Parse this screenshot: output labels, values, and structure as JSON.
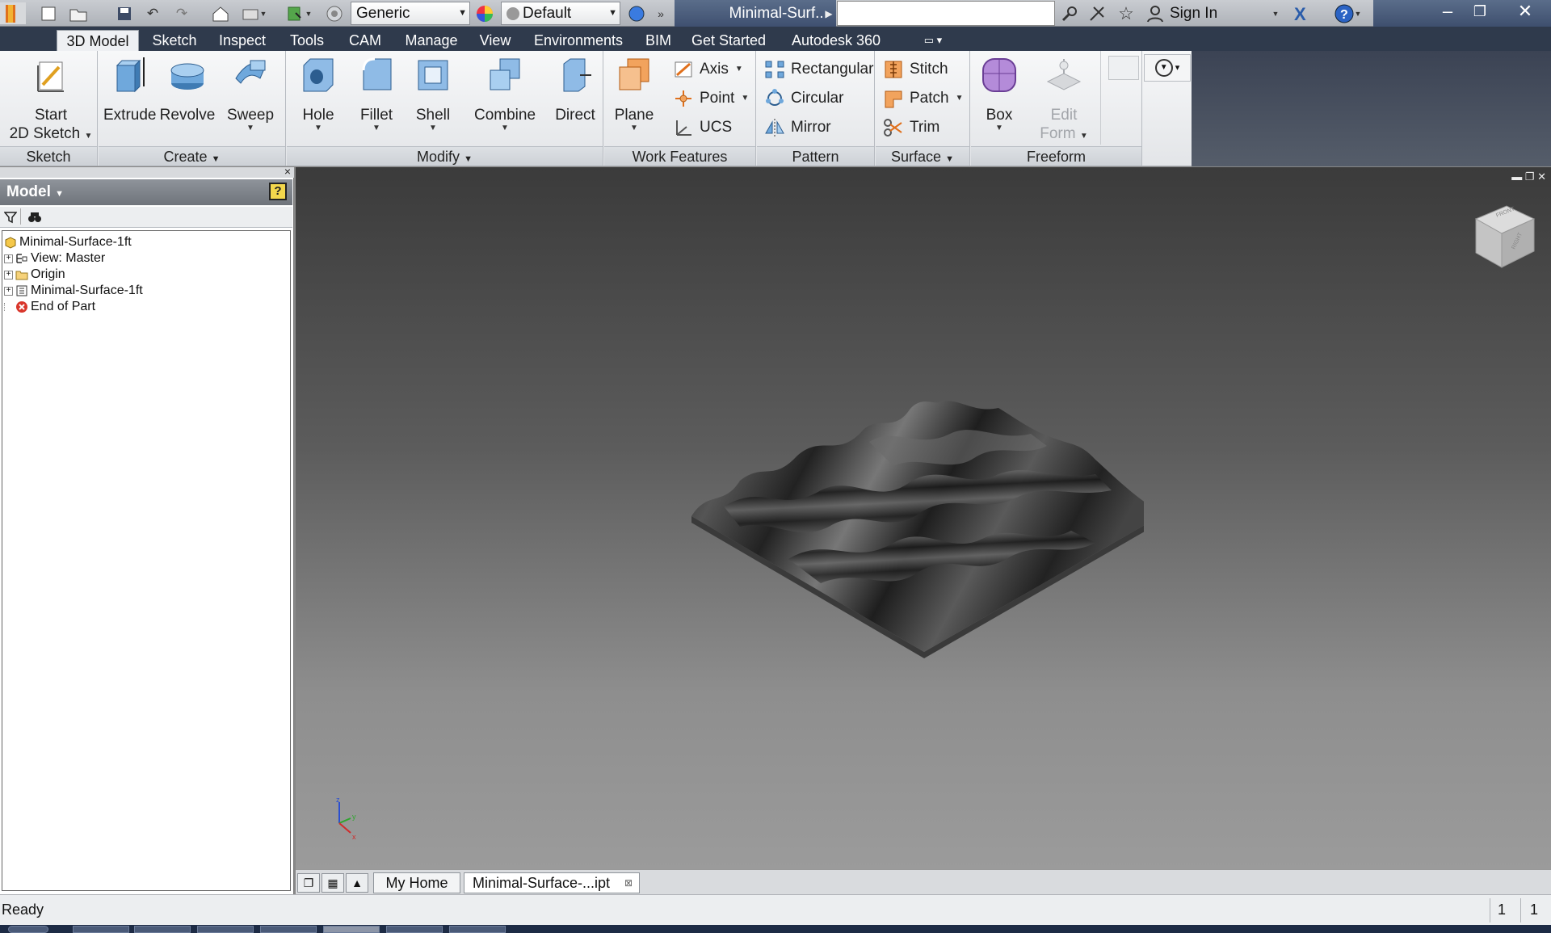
{
  "title_bar": {
    "material_combo": "Generic",
    "appearance_combo": "Default",
    "document_title": "Minimal-Surf...",
    "sign_in": "Sign In"
  },
  "ribbon_tabs": [
    "3D Model",
    "Sketch",
    "Inspect",
    "Tools",
    "CAM",
    "Manage",
    "View",
    "Environments",
    "BIM",
    "Get Started",
    "Autodesk 360"
  ],
  "ribbon": {
    "sketch": {
      "start_line1": "Start",
      "start_line2": "2D Sketch",
      "panel": "Sketch"
    },
    "create": {
      "extrude": "Extrude",
      "revolve": "Revolve",
      "sweep": "Sweep",
      "panel": "Create"
    },
    "modify": {
      "hole": "Hole",
      "fillet": "Fillet",
      "shell": "Shell",
      "combine": "Combine",
      "direct": "Direct",
      "panel": "Modify"
    },
    "work_features": {
      "plane": "Plane",
      "axis": "Axis",
      "point": "Point",
      "ucs": "UCS",
      "panel": "Work Features"
    },
    "pattern": {
      "rectangular": "Rectangular",
      "circular": "Circular",
      "mirror": "Mirror",
      "panel": "Pattern"
    },
    "surface": {
      "stitch": "Stitch",
      "patch": "Patch",
      "trim": "Trim",
      "panel": "Surface"
    },
    "freeform": {
      "box": "Box",
      "edit_form_line1": "Edit",
      "edit_form_line2": "Form",
      "panel": "Freeform"
    }
  },
  "browser": {
    "title": "Model",
    "tree": [
      {
        "label": "Minimal-Surface-1ft"
      },
      {
        "label": "View: Master"
      },
      {
        "label": "Origin"
      },
      {
        "label": "Minimal-Surface-1ft"
      },
      {
        "label": "End of Part"
      }
    ]
  },
  "viewcube": {
    "front": "FRONT",
    "right": "RIGHT"
  },
  "document_tabs": {
    "home": "My Home",
    "active": "Minimal-Surface-...ipt"
  },
  "status": {
    "text": "Ready",
    "count1": "1",
    "count2": "1"
  },
  "colors": {
    "tab_bar": "#2f3a4c",
    "title_accent": "#4a5d7c",
    "model_surface": "#2a2a2a"
  }
}
